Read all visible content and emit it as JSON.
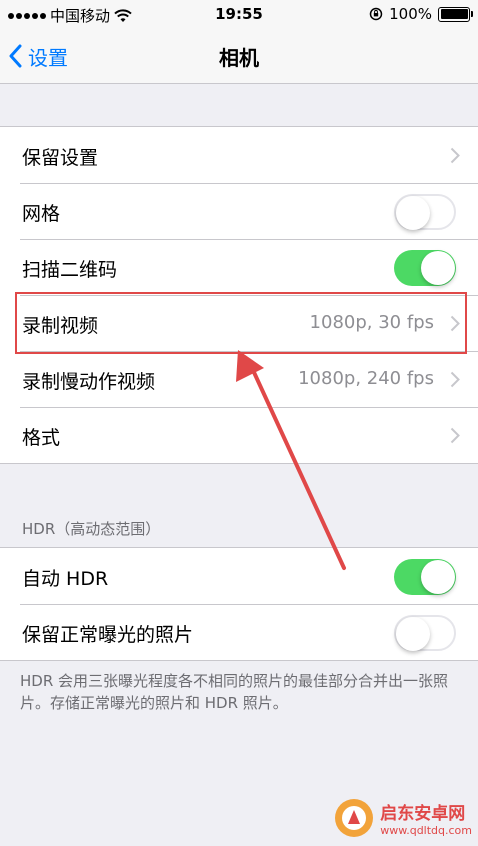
{
  "status_bar": {
    "carrier": "中国移动",
    "time": "19:55",
    "battery_percent": "100%",
    "battery_level": 1.0
  },
  "nav": {
    "back_label": "设置",
    "title": "相机"
  },
  "group1": {
    "rows": [
      {
        "label": "保留设置",
        "type": "chevron"
      },
      {
        "label": "网格",
        "type": "toggle",
        "on": false
      },
      {
        "label": "扫描二维码",
        "type": "toggle",
        "on": true
      },
      {
        "label": "录制视频",
        "value": "1080p, 30 fps",
        "type": "chevron"
      },
      {
        "label": "录制慢动作视频",
        "value": "1080p, 240 fps",
        "type": "chevron"
      },
      {
        "label": "格式",
        "type": "chevron"
      }
    ]
  },
  "hdr_section": {
    "header": "HDR（高动态范围）",
    "rows": [
      {
        "label": "自动 HDR",
        "type": "toggle",
        "on": true
      },
      {
        "label": "保留正常曝光的照片",
        "type": "toggle",
        "on": false
      }
    ],
    "footer": "HDR 会用三张曝光程度各不相同的照片的最佳部分合并出一张照片。存储正常曝光的照片和 HDR 照片。"
  },
  "watermark": {
    "name": "启东安卓网",
    "url": "www.qdltdq.com"
  },
  "colors": {
    "accent": "#007aff",
    "toggle_on": "#4cd964",
    "annotation": "#e04848"
  }
}
